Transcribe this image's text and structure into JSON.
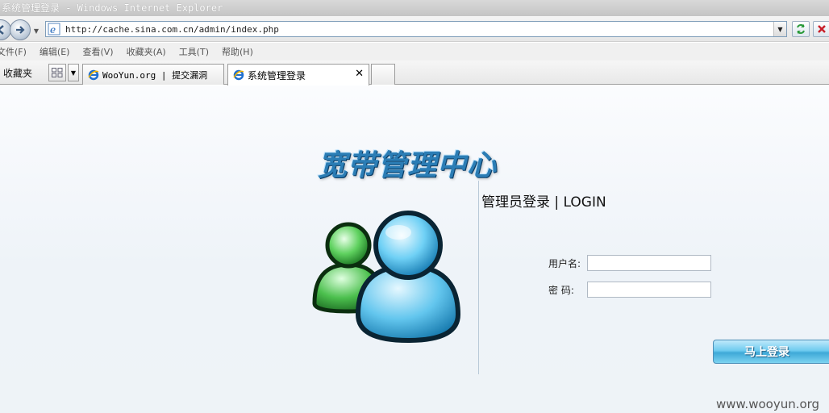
{
  "window": {
    "title": "系统管理登录 - Windows Internet Explorer"
  },
  "address_bar": {
    "url": "http://cache.sina.com.cn/admin/index.php"
  },
  "menu": {
    "items": [
      "文件(F)",
      "编辑(E)",
      "查看(V)",
      "收藏夹(A)",
      "工具(T)",
      "帮助(H)"
    ]
  },
  "tabbar": {
    "favorites_label": "收藏夹",
    "tabs": [
      {
        "label": "WooYun.org | 提交漏洞"
      },
      {
        "label": "系统管理登录"
      }
    ]
  },
  "page": {
    "brand_title": "宽带管理中心",
    "login_heading": "管理员登录 | LOGIN",
    "username_label": "用户名:",
    "password_label": "密 码:",
    "username_value": "",
    "password_value": "",
    "login_button": "马上登录",
    "watermark": "www.wooyun.org"
  },
  "colors": {
    "brand": "#2b7db5",
    "button": "#3ea9d8"
  }
}
